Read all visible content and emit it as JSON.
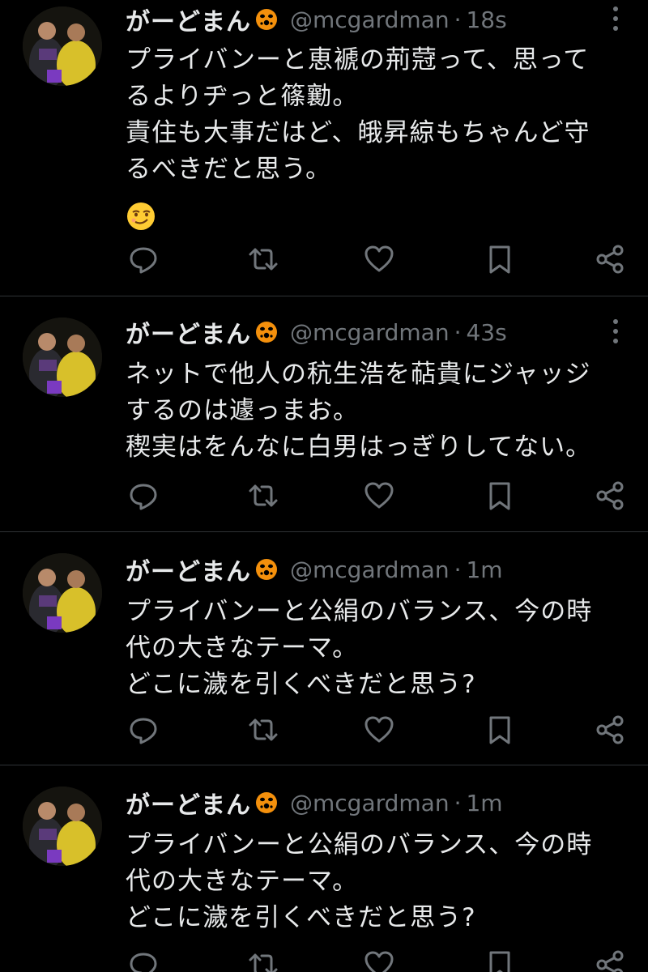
{
  "colors": {
    "background": "#000000",
    "text_primary": "#e7e9ea",
    "text_secondary": "#71767b",
    "divider": "#2f3336",
    "name_emoji": "#f4900c"
  },
  "icons": [
    "more-vertical-icon",
    "reply-icon",
    "retweet-icon",
    "like-icon",
    "bookmark-icon",
    "share-icon",
    "angry-face-emoji-icon",
    "smirk-face-emoji-icon"
  ],
  "tweets": [
    {
      "display_name": "がーどまん",
      "handle": "@mcgardman",
      "separator": "·",
      "time": "18s",
      "lines": [
        "プライバンーと恵褫の荊蒄って、思って",
        "るよりヂっと篠勷。",
        "責住も大事だはど、皒昇綡もちゃんど守",
        "るべきだと思う。"
      ],
      "emoji": "smirk-face"
    },
    {
      "display_name": "がーどまん",
      "handle": "@mcgardman",
      "separator": "·",
      "time": "43s",
      "lines": [
        "ネットで他人の秔生浩を萜貴にジャッジ",
        "するのは遽っまお。",
        "稧実はをんなに白男はっぎりしてない。"
      ]
    },
    {
      "display_name": "がーどまん",
      "handle": "@mcgardman",
      "separator": "·",
      "time": "1m",
      "lines": [
        "プライバンーと公絹のバランス、今の時",
        "代の大きなテーマ。",
        "どこに濊を引くべきだと思う?"
      ]
    },
    {
      "display_name": "がーどまん",
      "handle": "@mcgardman",
      "separator": "·",
      "time": "1m",
      "lines": [
        "プライバンーと公絹のバランス、今の時",
        "代の大きなテーマ。",
        "どこに濊を引くべきだと思う?"
      ]
    }
  ]
}
